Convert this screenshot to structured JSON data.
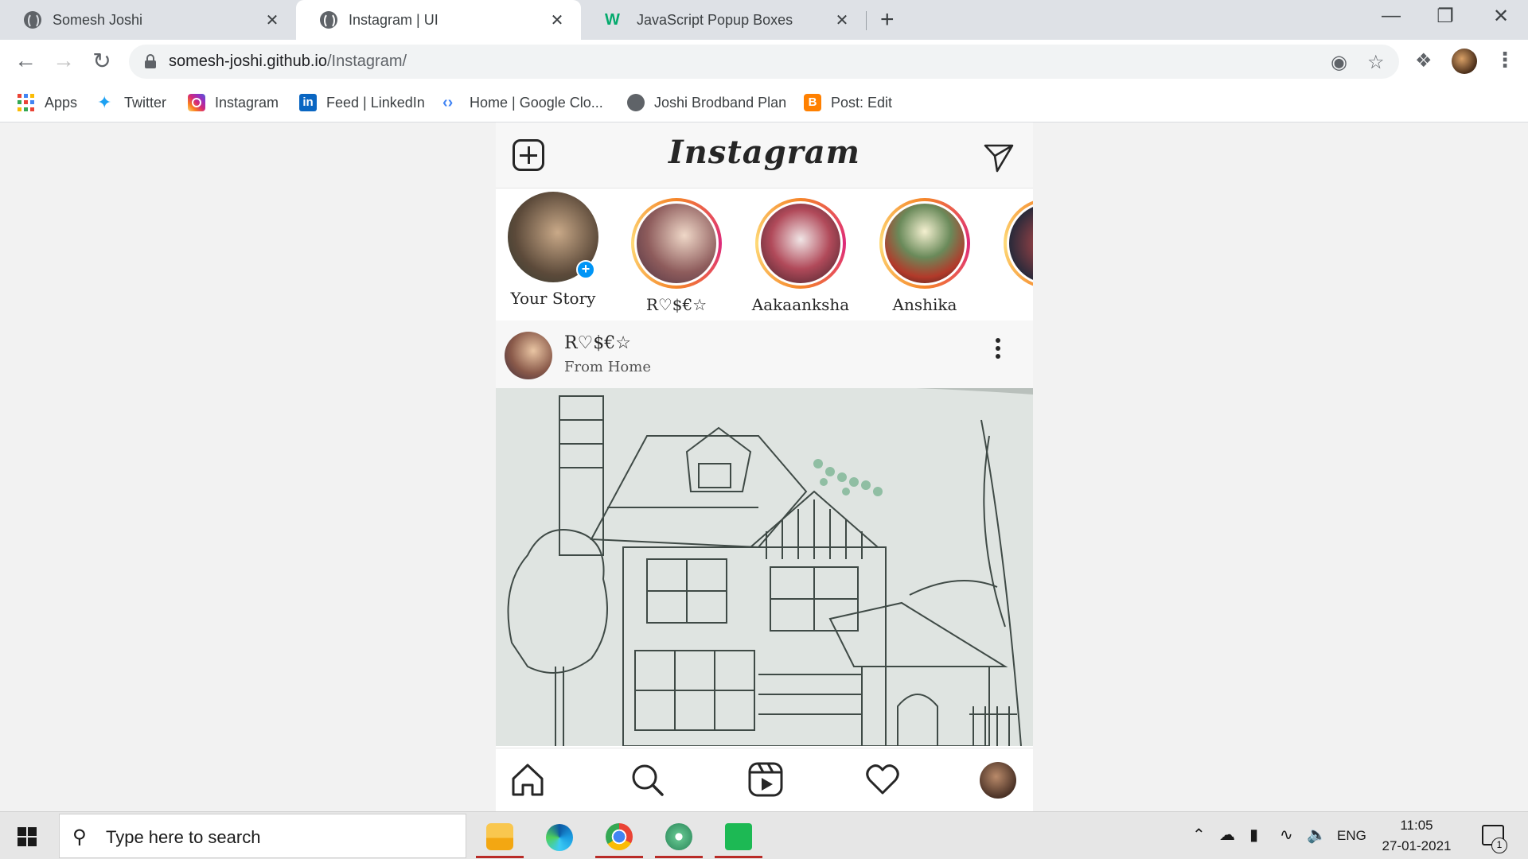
{
  "browser": {
    "tabs": [
      {
        "title": "Somesh Joshi",
        "active": false,
        "icon": "globe-icon"
      },
      {
        "title": "Instagram | UI",
        "active": true,
        "icon": "globe-icon"
      },
      {
        "title": "JavaScript Popup Boxes",
        "active": false,
        "icon": "w3schools-icon"
      }
    ],
    "close_glyph": "✕",
    "new_tab_glyph": "+",
    "window_controls": {
      "minimize": "—",
      "restore": "❐",
      "close": "✕"
    },
    "address": {
      "host": "somesh-joshi.github.io",
      "path": "/Instagram/"
    },
    "bookmarks": [
      {
        "label": "Apps",
        "icon": "apps-grid-icon"
      },
      {
        "label": "Twitter",
        "icon": "twitter-icon"
      },
      {
        "label": "Instagram",
        "icon": "instagram-icon"
      },
      {
        "label": "Feed | LinkedIn",
        "icon": "linkedin-icon"
      },
      {
        "label": "Home | Google Clo...",
        "icon": "google-cloud-icon"
      },
      {
        "label": "Joshi Brodband Plan",
        "icon": "globe-icon"
      },
      {
        "label": "Post: Edit",
        "icon": "blogger-icon"
      }
    ]
  },
  "instagram": {
    "logo": "Instagram",
    "stories": [
      {
        "name": "Your Story",
        "own": true
      },
      {
        "name": "R♡$€☆",
        "own": false
      },
      {
        "name": "Aakaanksha",
        "own": false
      },
      {
        "name": "Anshika",
        "own": false
      },
      {
        "name": "",
        "own": false
      }
    ],
    "post": {
      "username": "R♡$€☆",
      "location": "From Home"
    }
  },
  "taskbar": {
    "search_placeholder": "Type here to search",
    "language": "ENG",
    "time": "11:05",
    "date": "27-01-2021",
    "notification_count": "1"
  },
  "colors": {
    "story_ring": "#dd2a7b",
    "accent_blue": "#0095f6"
  }
}
